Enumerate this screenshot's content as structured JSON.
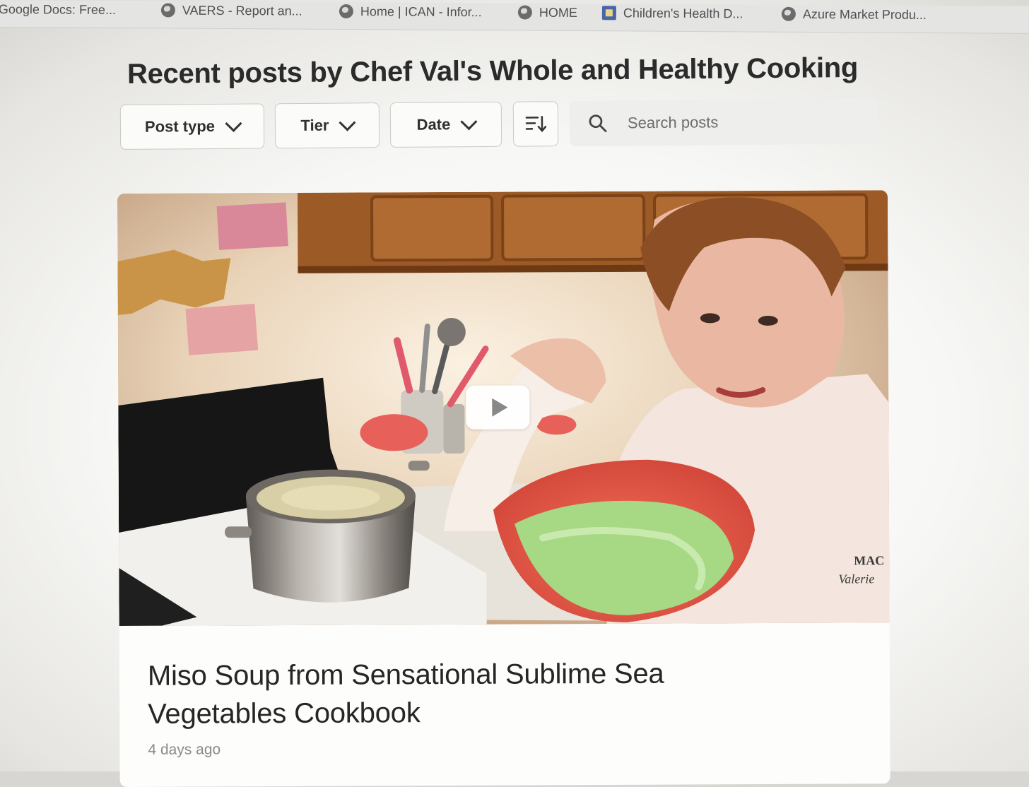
{
  "bookmarks": [
    {
      "label": "Google Docs: Free...",
      "icon": "google-docs-icon"
    },
    {
      "label": "VAERS - Report an...",
      "icon": "globe-icon"
    },
    {
      "label": "Home | ICAN - Infor...",
      "icon": "globe-icon"
    },
    {
      "label": "HOME",
      "icon": "globe-icon"
    },
    {
      "label": "Children's Health D...",
      "icon": "chd-icon"
    },
    {
      "label": "Azure Market Produ...",
      "icon": "globe-icon"
    }
  ],
  "page": {
    "title": "Recent posts by Chef Val's Whole and Healthy Cooking"
  },
  "filters": {
    "post_type": "Post type",
    "tier": "Tier",
    "date": "Date",
    "sort_icon": "sort-icon",
    "search_placeholder": "Search posts",
    "search_value": ""
  },
  "post": {
    "title": "Miso Soup from Sensational Sublime Sea Vegetables Cookbook",
    "date": "4 days ago",
    "thumbnail_type": "video",
    "apron_text_line1": "MAC",
    "apron_text_line2": "Valerie"
  },
  "colors": {
    "page_background": "#ffffff",
    "text_primary": "#2b2b2b",
    "text_muted": "#8a8a88",
    "button_border": "#c9c9c6",
    "search_background": "#eeeeec"
  }
}
